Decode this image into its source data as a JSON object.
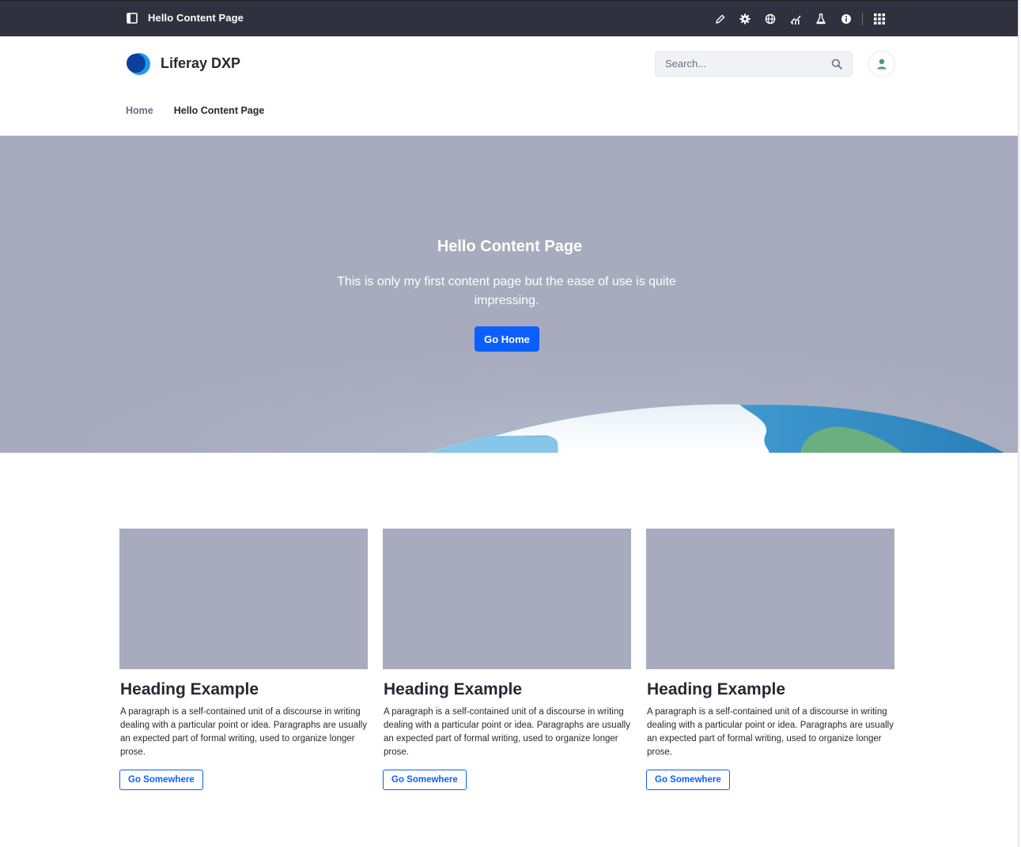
{
  "control_menu": {
    "page_title": "Hello Content Page",
    "icons": [
      "pencil-icon",
      "gear-icon",
      "globe-icon",
      "analytics-icon",
      "flask-icon",
      "info-icon"
    ],
    "apps_icon": "apps-grid-icon"
  },
  "header": {
    "site_name": "Liferay DXP",
    "search_placeholder": "Search...",
    "nav": [
      {
        "label": "Home",
        "active": false
      },
      {
        "label": "Hello Content Page",
        "active": true
      }
    ]
  },
  "hero": {
    "title": "Hello Content Page",
    "subtitle": "This is only my first content page but the ease of use is quite impressing.",
    "button_label": "Go Home"
  },
  "cards": [
    {
      "heading": "Heading Example",
      "text": "A paragraph is a self-contained unit of a discourse in writing dealing with a particular point or idea. Paragraphs are usually an expected part of formal writing, used to organize longer prose.",
      "button_label": "Go Somewhere"
    },
    {
      "heading": "Heading Example",
      "text": "A paragraph is a self-contained unit of a discourse in writing dealing with a particular point or idea. Paragraphs are usually an expected part of formal writing, used to organize longer prose.",
      "button_label": "Go Somewhere"
    },
    {
      "heading": "Heading Example",
      "text": "A paragraph is a self-contained unit of a discourse in writing dealing with a particular point or idea. Paragraphs are usually an expected part of formal writing, used to organize longer prose.",
      "button_label": "Go Somewhere"
    }
  ],
  "colors": {
    "control_menu_bg": "#30313f",
    "primary": "#0b5fff",
    "hero_bg": "#a7abbd",
    "text": "#272833",
    "muted": "#6b6c7e"
  }
}
